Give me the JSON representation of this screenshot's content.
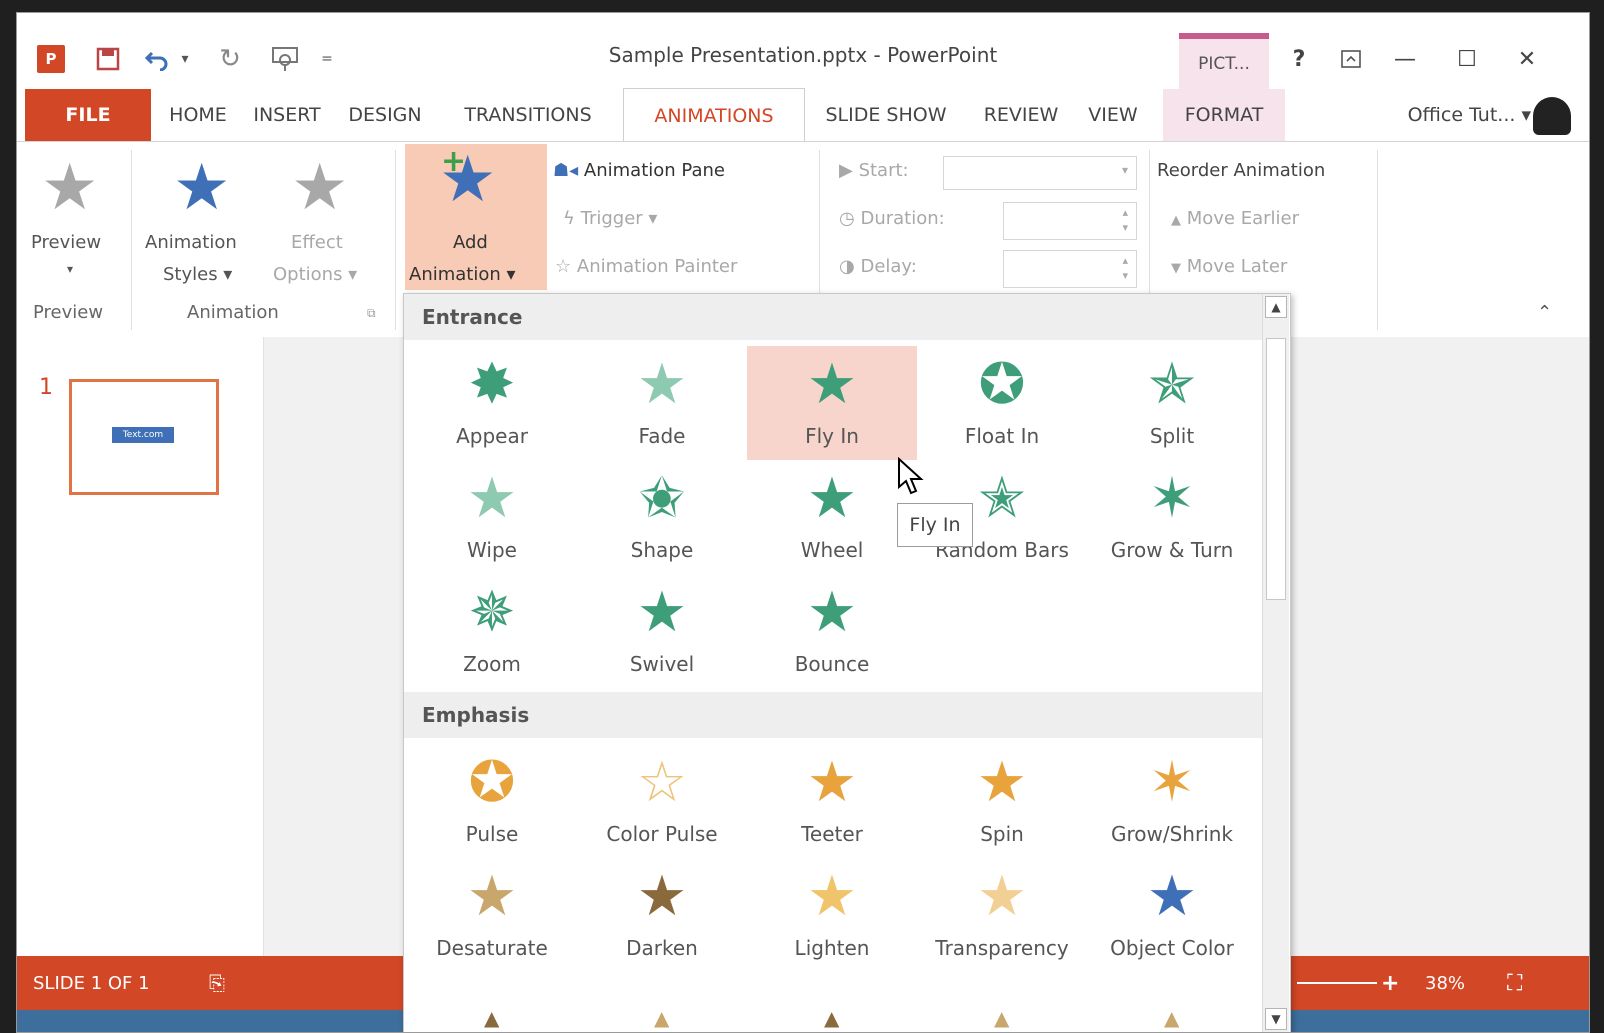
{
  "window": {
    "title": "Sample Presentation.pptx - PowerPoint",
    "context_tab": "PICT...",
    "help": "?",
    "restore": "⧉",
    "minimize": "—",
    "maximize": "☐",
    "close": "✕"
  },
  "qat": {
    "app_icon": "powerpoint-logo",
    "save": "💾",
    "undo": "↶",
    "undo_arrow": "▾",
    "redo": "↻",
    "present": "◫",
    "customize": "⇅"
  },
  "tabs": [
    "FILE",
    "HOME",
    "INSERT",
    "DESIGN",
    "TRANSITIONS",
    "ANIMATIONS",
    "SLIDE SHOW",
    "REVIEW",
    "VIEW",
    "FORMAT"
  ],
  "account": "Office Tut... ▾",
  "ribbon": {
    "preview": {
      "label": "Preview",
      "arrow": "▾",
      "group": "Preview"
    },
    "animation_styles": {
      "line1": "Animation",
      "line2": "Styles ▾"
    },
    "effect_options": {
      "line1": "Effect",
      "line2": "Options ▾"
    },
    "animation_group": "Animation",
    "add_animation": {
      "line1": "Add",
      "line2": "Animation ▾"
    },
    "animation_pane": "Animation Pane",
    "trigger": "Trigger ▾",
    "animation_painter": "Animation Painter",
    "start": "Start:",
    "duration": "Duration:",
    "delay": "Delay:",
    "reorder": "Reorder Animation",
    "move_earlier": "Move Earlier",
    "move_later": "Move Later",
    "collapse": "⌃"
  },
  "slides": {
    "number": "1",
    "thumb_text": "Text.com"
  },
  "status": {
    "slide": "SLIDE 1 OF 1",
    "zoom": "38%",
    "zoom_plus": "+"
  },
  "gallery": {
    "entrance_header": "Entrance",
    "entrance": [
      "Appear",
      "Fade",
      "Fly In",
      "Float In",
      "Split",
      "Wipe",
      "Shape",
      "Wheel",
      "Random Bars",
      "Grow & Turn",
      "Zoom",
      "Swivel",
      "Bounce"
    ],
    "emphasis_header": "Emphasis",
    "emphasis": [
      "Pulse",
      "Color Pulse",
      "Teeter",
      "Spin",
      "Grow/Shrink",
      "Desaturate",
      "Darken",
      "Lighten",
      "Transparency",
      "Object Color"
    ],
    "tooltip": "Fly In",
    "entrance_color": "#3f9e7a",
    "emphasis_color": "#e8a33c"
  }
}
